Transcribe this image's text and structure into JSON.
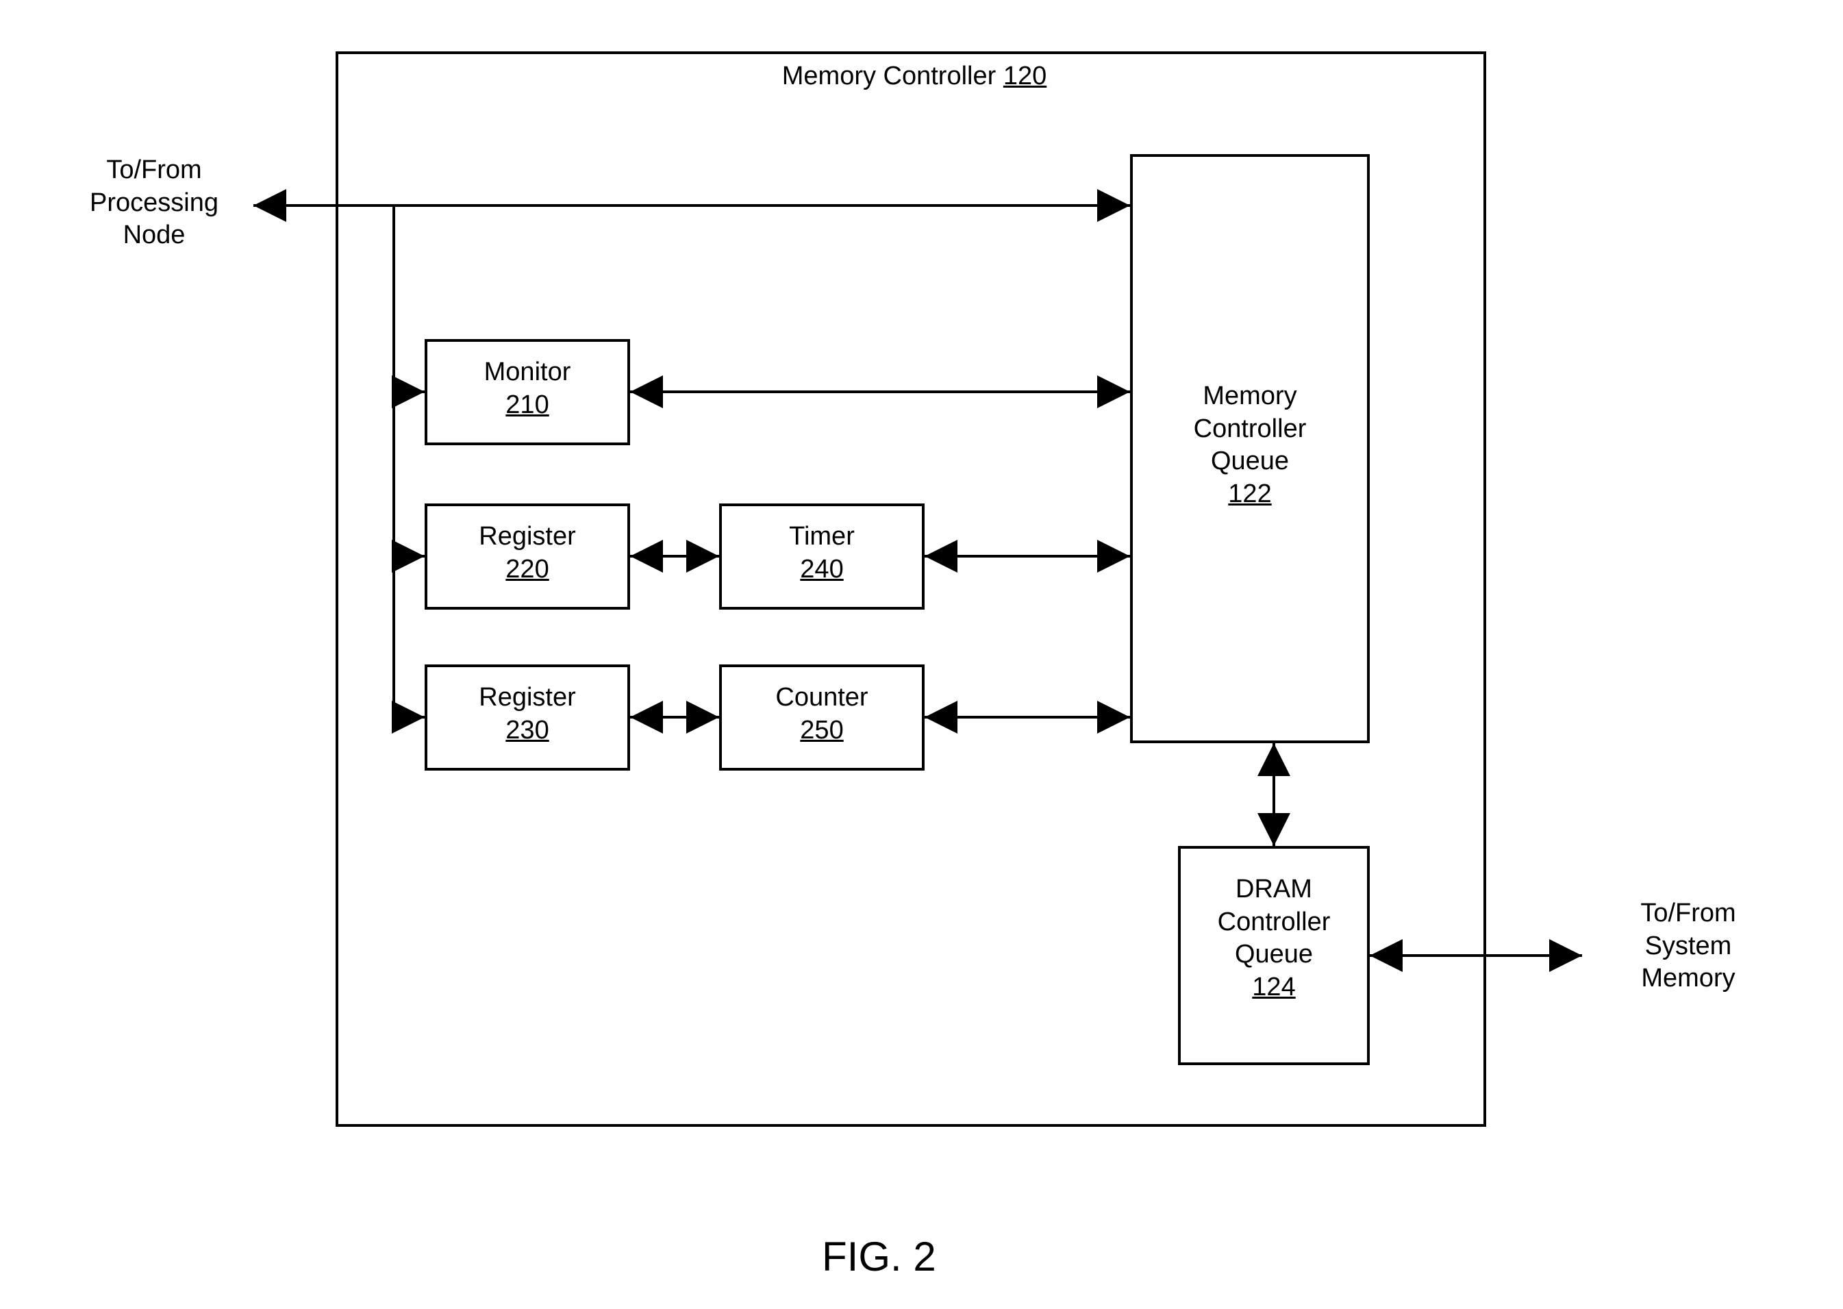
{
  "figure_label": "FIG. 2",
  "outer_left_label_line1": "To/From",
  "outer_left_label_line2": "Processing",
  "outer_left_label_line3": "Node",
  "outer_right_label_line1": "To/From",
  "outer_right_label_line2": "System",
  "outer_right_label_line3": "Memory",
  "memory_controller": {
    "title": "Memory Controller",
    "ref": "120"
  },
  "monitor": {
    "title": "Monitor",
    "ref": "210"
  },
  "register1": {
    "title": "Register",
    "ref": "220"
  },
  "register2": {
    "title": "Register",
    "ref": "230"
  },
  "timer": {
    "title": "Timer",
    "ref": "240"
  },
  "counter": {
    "title": "Counter",
    "ref": "250"
  },
  "mcq": {
    "title_line1": "Memory",
    "title_line2": "Controller",
    "title_line3": "Queue",
    "ref": "122"
  },
  "dcq": {
    "title_line1": "DRAM",
    "title_line2": "Controller",
    "title_line3": "Queue",
    "ref": "124"
  }
}
